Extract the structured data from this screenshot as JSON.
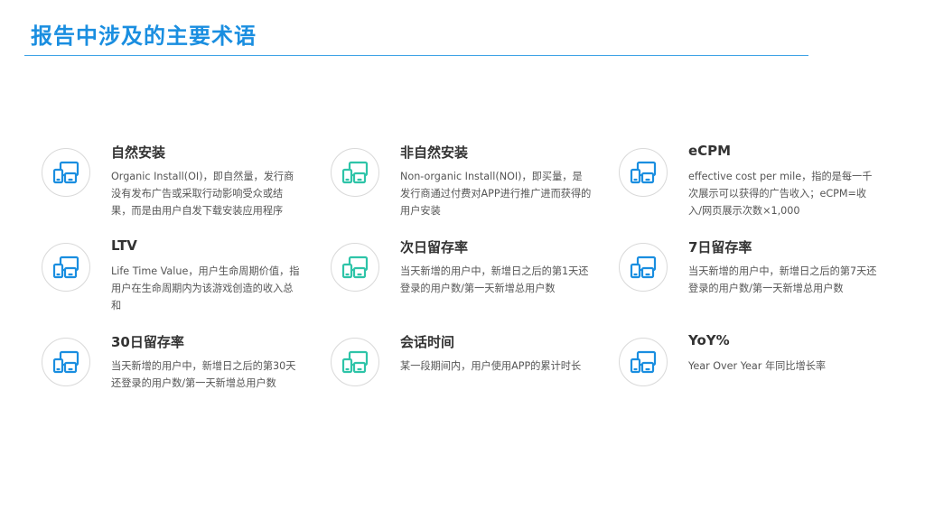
{
  "page": {
    "title": "报告中涉及的主要术语"
  },
  "colors": {
    "accent": "#1a8ee0",
    "icon_blue": "#1a8ee0",
    "icon_teal": "#2ec4a8"
  },
  "terms": [
    {
      "title": "自然安装",
      "desc": "Organic Install(OI)，即自然量，发行商没有发布广告或采取行动影响受众或结果，而是由用户自发下载安装应用程序",
      "icon": "devices-icon"
    },
    {
      "title": "非自然安装",
      "desc": "Non-organic Install(NOI)，即买量，是发行商通过付费对APP进行推广进而获得的用户安装",
      "icon": "devices-icon"
    },
    {
      "title": "eCPM",
      "desc": "effective cost per mile，指的是每一千次展示可以获得的广告收入；eCPM=收入/网页展示次数×1,000",
      "icon": "devices-icon"
    },
    {
      "title": "LTV",
      "desc": "Life Time Value，用户生命周期价值，指用户在生命周期内为该游戏创造的收入总和",
      "icon": "devices-icon"
    },
    {
      "title": "次日留存率",
      "desc": "当天新增的用户中，新增日之后的第1天还登录的用户数/第一天新增总用户数",
      "icon": "devices-icon"
    },
    {
      "title": "7日留存率",
      "desc": "当天新增的用户中，新增日之后的第7天还登录的用户数/第一天新增总用户数",
      "icon": "devices-icon"
    },
    {
      "title": "30日留存率",
      "desc": "当天新增的用户中，新增日之后的第30天还登录的用户数/第一天新增总用户数",
      "icon": "devices-icon"
    },
    {
      "title": "会话时间",
      "desc": "某一段期间内，用户使用APP的累计时长",
      "icon": "devices-icon"
    },
    {
      "title": "YoY%",
      "desc": "Year Over Year 年同比增长率",
      "icon": "devices-icon"
    }
  ]
}
